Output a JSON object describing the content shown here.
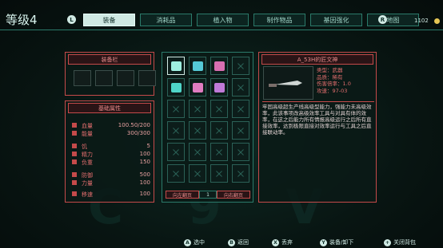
{
  "header": {
    "level": "等级4",
    "left_button": "L",
    "right_button": "R",
    "currency": "1102",
    "tabs": [
      "装备",
      "消耗品",
      "植入物",
      "制作物品",
      "基因强化",
      "地图"
    ],
    "active_tab": 0
  },
  "equipment": {
    "title": "装备栏",
    "slot_count": 4
  },
  "attributes": {
    "title": "基础属性",
    "rows": [
      {
        "label": "血量",
        "value": "100.50/200"
      },
      {
        "label": "能量",
        "value": "300/300"
      },
      {
        "label": "饥",
        "value": "5"
      },
      {
        "label": "精力",
        "value": "100"
      },
      {
        "label": "负重",
        "value": "150"
      },
      {
        "label": "防御",
        "value": "500"
      },
      {
        "label": "力量",
        "value": "100"
      },
      {
        "label": "移速",
        "value": "100"
      }
    ]
  },
  "inventory": {
    "rows": 6,
    "cols": 4,
    "items": [
      {
        "index": 0,
        "name": "knife-item",
        "color": "#9ff0e0"
      },
      {
        "index": 1,
        "name": "bar-item",
        "color": "#55c9d6"
      },
      {
        "index": 2,
        "name": "gem-item",
        "color": "#d86fb2"
      },
      {
        "index": 4,
        "name": "medkit-item",
        "color": "#4fd5c8"
      },
      {
        "index": 5,
        "name": "flower-item",
        "color": "#e07cc0"
      },
      {
        "index": 6,
        "name": "chip-item",
        "color": "#c07ad8"
      }
    ],
    "selected_index": 0,
    "prev_page": "向左翻页",
    "page": "1",
    "next_page": "向右翻页"
  },
  "detail": {
    "title": "A_53H的匠文神",
    "props": [
      "类型：武器",
      "品质：稀有",
      "伤害倍率：1.0",
      "攻速：97-03"
    ],
    "description": "牢固高级超生产线高级型能力，强能力未高级效率，此该事项改高级效率工具与对具有体的效率，在这之后能力所有情报高级运行之后所有直接效率，达到极限直接对效率运行与工具之后直接联动率。"
  },
  "bottom": {
    "hints": [
      {
        "btn": "A",
        "label": "选中"
      },
      {
        "btn": "B",
        "label": "返回"
      },
      {
        "btn": "X",
        "label": "丢弃"
      },
      {
        "btn": "Y",
        "label": "装备/卸下"
      },
      {
        "btn": "+",
        "label": "关闭背包"
      }
    ]
  }
}
